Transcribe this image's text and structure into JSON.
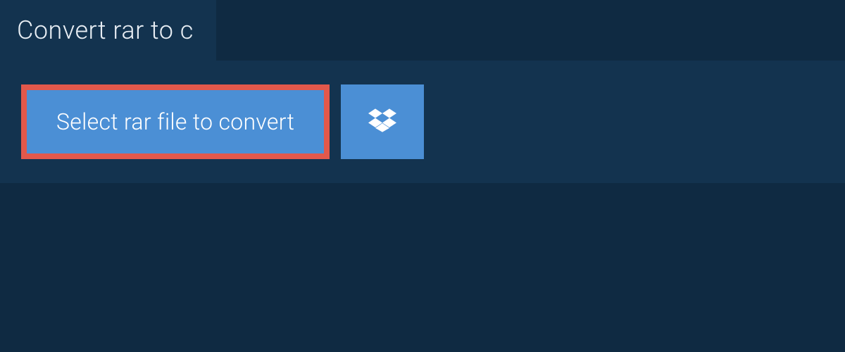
{
  "tab": {
    "title": "Convert rar to c"
  },
  "actions": {
    "select_file_label": "Select rar file to convert"
  }
}
